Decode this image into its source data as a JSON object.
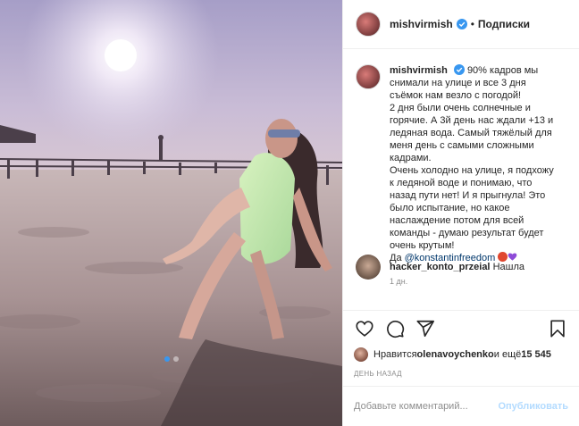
{
  "header": {
    "username": "mishvirmish",
    "separator": "•",
    "follow_label": "Подписки"
  },
  "caption": {
    "username": "mishvirmish",
    "lines": [
      "90% кадров мы",
      "снимали на улице и все 3 дня",
      "съёмок нам везло с погодой!",
      "2 дня были очень солнечные и",
      "горячие. А 3й день нас ждали +13 и",
      "ледяная вода. Самый тяжёлый для",
      "меня день с самыми сложными",
      "кадрами.",
      "Очень холодно на улице, я подхожу",
      "к ледяной воде и понимаю, что",
      "назад пути нет! И я прыгнула! Это",
      "было испытание, но какое",
      "наслаждение потом для всей",
      "команды - думаю результат будет",
      "очень крутым!"
    ],
    "last_prefix": "Да ",
    "mention": "@konstantinfreedom",
    "time": "1 дн."
  },
  "comment": {
    "username": "hacker_konto_przeial",
    "text": "Нашла"
  },
  "likes": {
    "prefix": "Нравится ",
    "user": "olenavoychenko",
    "middle": " и ещё ",
    "count": "15 545"
  },
  "date_label": "ДЕНЬ НАЗАД",
  "add_comment": {
    "placeholder": "Добавьте комментарий...",
    "publish_label": "Опубликовать"
  },
  "icons": {
    "like": "heart-icon",
    "comment": "comment-icon",
    "share": "share-icon",
    "save": "bookmark-icon",
    "verified": "verified-badge-icon"
  },
  "colors": {
    "verified_blue": "#3897f0",
    "publish_disabled": "#b3dbff",
    "mention": "#00376b"
  }
}
